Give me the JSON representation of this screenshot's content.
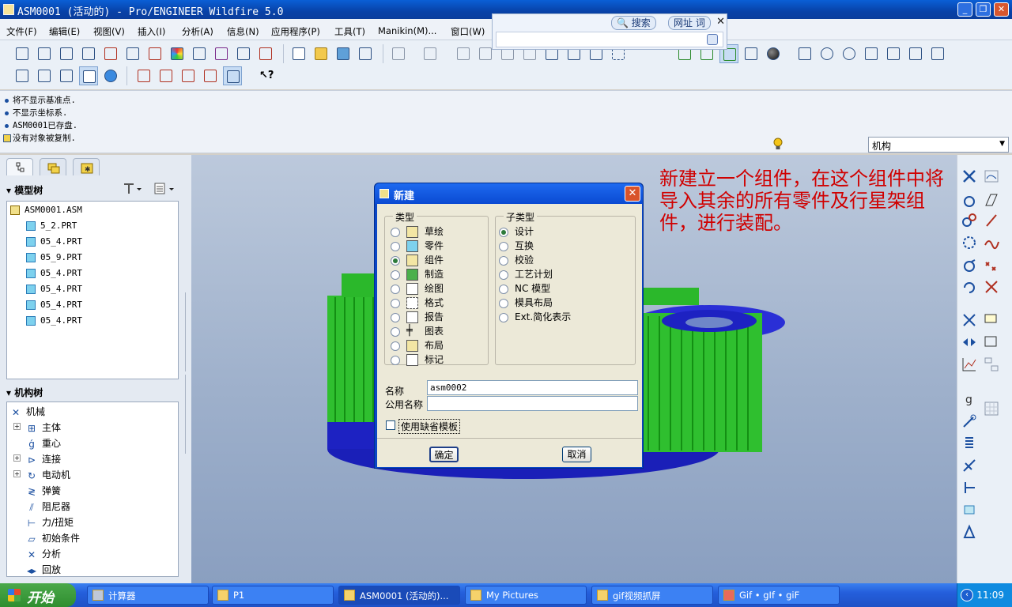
{
  "window": {
    "title": "ASM0001 (活动的) - Pro/ENGINEER Wildfire 5.0"
  },
  "menu": {
    "items": [
      "文件(F)",
      "编辑(E)",
      "视图(V)",
      "插入(I)",
      "分析(A)",
      "信息(N)",
      "应用程序(P)",
      "工具(T)",
      "Manikin(M)...",
      "窗口(W)"
    ]
  },
  "search_popup": {
    "search_label": "搜索",
    "url_label": "网址 词"
  },
  "messages": [
    "将不显示基准点.",
    "不显示坐标系.",
    "ASM0001已存盘.",
    "没有对象被复制."
  ],
  "filter": {
    "value": "机构"
  },
  "model_tree": {
    "header": "模型树",
    "root": "ASM0001.ASM",
    "items": [
      "5_2.PRT",
      "05_4.PRT",
      "05_9.PRT",
      "05_4.PRT",
      "05_4.PRT",
      "05_4.PRT",
      "05_4.PRT"
    ]
  },
  "mech_tree": {
    "header": "机构树",
    "root": "机械",
    "items": [
      "主体",
      "重心",
      "连接",
      "电动机",
      "弹簧",
      "阻尼器",
      "力/扭矩",
      "初始条件",
      "分析",
      "回放"
    ]
  },
  "annotation": {
    "text": "新建立一个组件，在这个组件中将导入其余的所有零件及行星架组件，进行装配。"
  },
  "dialog": {
    "title": "新建",
    "type_group": "类型",
    "types": [
      "草绘",
      "零件",
      "组件",
      "制造",
      "绘图",
      "格式",
      "报告",
      "图表",
      "布局",
      "标记"
    ],
    "selected_type": "组件",
    "subtype_group": "子类型",
    "subtypes": [
      "设计",
      "互换",
      "校验",
      "工艺计划",
      "NC 模型",
      "模具布局",
      "Ext.简化表示"
    ],
    "selected_subtype": "设计",
    "name_label": "名称",
    "name_value": "asm0002",
    "common_name_label": "公用名称",
    "common_name_value": "",
    "use_default_template_label": "使用缺省模板",
    "use_default_template_checked": false,
    "ok_label": "确定",
    "cancel_label": "取消"
  },
  "taskbar": {
    "start_label": "开始",
    "tasks": [
      "计算器",
      "P1",
      "ASM0001 (活动的)...",
      "My Pictures",
      "gif视频抓屏",
      "Gif • gIf • giF"
    ],
    "clock": "11:09"
  },
  "colors": {
    "gear_green": "#2fbf2f",
    "carrier_blue": "#1a1fb8",
    "annotation_red": "#d00000"
  }
}
